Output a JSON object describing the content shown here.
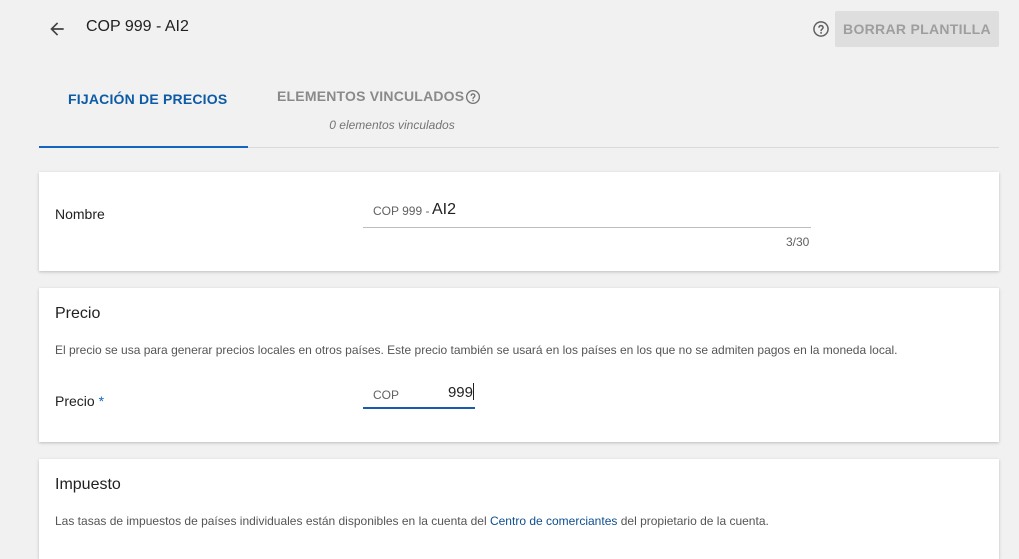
{
  "header": {
    "title": "COP 999 - AI2",
    "delete_label": "BORRAR PLANTILLA"
  },
  "tabs": [
    {
      "label": "FIJACIÓN DE PRECIOS",
      "active": true
    },
    {
      "label": "ELEMENTOS VINCULADOS",
      "subtitle": "0 elementos vinculados",
      "active": false
    }
  ],
  "name_card": {
    "label": "Nombre",
    "prefix": "COP 999 -",
    "value": "AI2",
    "counter": "3/30"
  },
  "price_card": {
    "title": "Precio",
    "description": "El precio se usa para generar precios locales en otros países. Este precio también se usará en los países en los que no se admiten pagos en la moneda local.",
    "field_label": "Precio",
    "required_mark": "*",
    "currency": "COP",
    "value": "999"
  },
  "tax_card": {
    "title": "Impuesto",
    "description_before": "Las tasas de impuestos de países individuales están disponibles en la cuenta del",
    "link_text": "Centro de comerciantes",
    "description_after": "del propietario de la cuenta."
  },
  "colors": {
    "accent": "#1565c0",
    "background": "#f1f1f1",
    "card": "#ffffff"
  },
  "icons": {
    "back": "arrow-back-icon",
    "help": "help-circle-icon"
  }
}
